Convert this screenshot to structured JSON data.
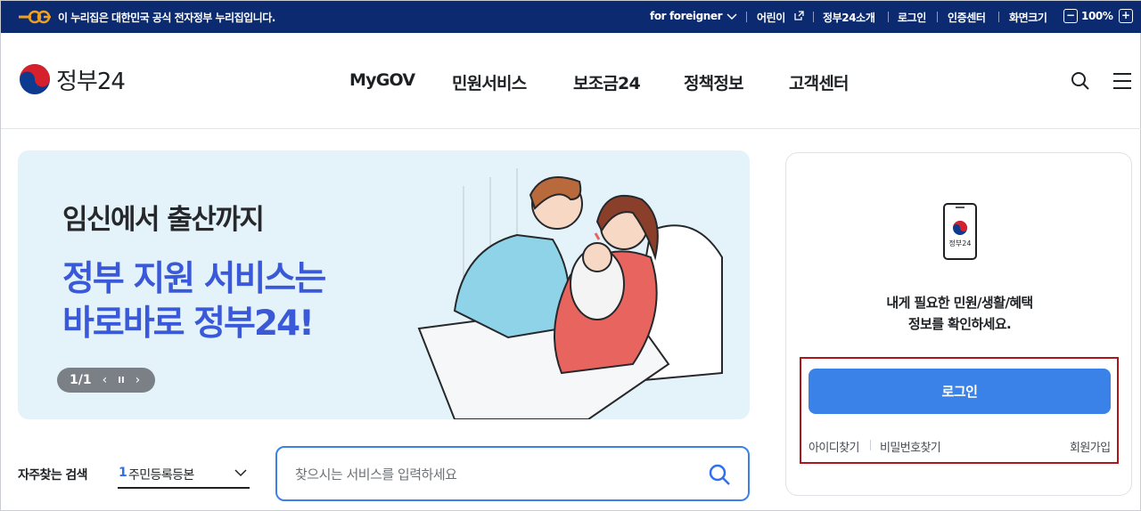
{
  "gov_bar": {
    "text": "이 누리집은 대한민국 공식 전자정부 누리집입니다.",
    "for_foreigner": "for foreigner",
    "kids": "어린이",
    "about": "정부24소개",
    "login": "로그인",
    "cert_center": "인증센터",
    "text_size": "화면크기",
    "zoom_minus": "−",
    "zoom_level": "100%",
    "zoom_plus": "+"
  },
  "header": {
    "brand": "정부24",
    "nav": [
      "MyGOV",
      "민원서비스",
      "보조금24",
      "정책정보",
      "고객센터"
    ]
  },
  "banner": {
    "headline": "임신에서 출산까지",
    "subline1": "정부 지원 서비스는",
    "subline2": "바로바로 정부24!",
    "slide_counter": "1/1",
    "prev": "‹",
    "pause": "II",
    "next": "›"
  },
  "search": {
    "freq_label": "자주찾는 검색",
    "freq_rank": "1",
    "freq_value": "주민등록등본",
    "placeholder": "찾으시는 서비스를 입력하세요"
  },
  "login_card": {
    "phone_brand": "정부24",
    "message_line1": "내게 필요한 민원/생활/혜택",
    "message_line2": "정보를 확인하세요.",
    "login_button": "로그인",
    "find_id": "아이디찾기",
    "find_pw": "비밀번호찾기",
    "signup": "회원가입"
  },
  "colors": {
    "gov_bar_bg": "#0b2a6f",
    "accent_blue": "#3b82e8",
    "banner_bg": "#e4f2fa",
    "banner_headline": "#3a59d8",
    "highlight_red": "#b0151b"
  },
  "icons": [
    "egov-logo",
    "external-link-icon",
    "chevron-down-icon",
    "taegeuk-logo",
    "search-icon",
    "menu-icon",
    "mobile-phone-icon"
  ]
}
